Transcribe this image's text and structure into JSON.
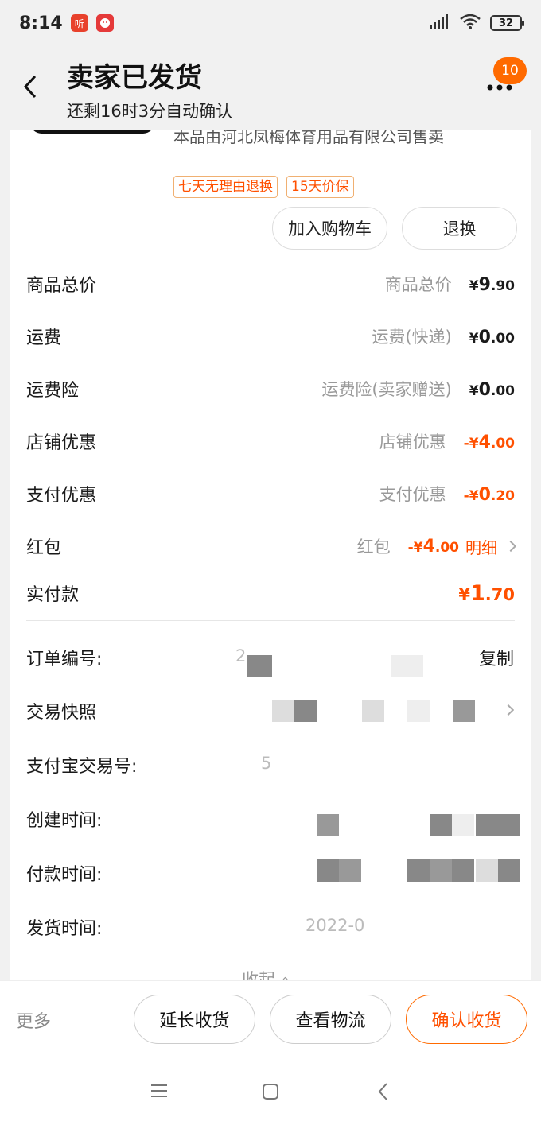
{
  "status": {
    "time": "8:14",
    "app1": "听",
    "app2": "",
    "battery": "32"
  },
  "header": {
    "title": "卖家已发货",
    "subtitle": "还剩16时3分自动确认",
    "badge": "10"
  },
  "product": {
    "seller_text": "本品由河北凤梅体育用品有限公司售卖",
    "tags": [
      "七天无理由退换",
      "15天价保"
    ],
    "add_cart": "加入购物车",
    "exchange": "退换"
  },
  "prices": [
    {
      "label": "商品总价",
      "sub": "商品总价",
      "yen": "¥",
      "int": "9",
      "dec": ".90",
      "orange": false
    },
    {
      "label": "运费",
      "sub": "运费(快递)",
      "yen": "¥",
      "int": "0",
      "dec": ".00",
      "orange": false
    },
    {
      "label": "运费险",
      "sub": "运费险(卖家赠送)",
      "yen": "¥",
      "int": "0",
      "dec": ".00",
      "orange": false
    },
    {
      "label": "店铺优惠",
      "sub": "店铺优惠",
      "yen": "-¥",
      "int": "4",
      "dec": ".00",
      "orange": true
    },
    {
      "label": "支付优惠",
      "sub": "支付优惠",
      "yen": "-¥",
      "int": "0",
      "dec": ".20",
      "orange": true
    },
    {
      "label": "红包",
      "sub": "红包",
      "yen": "-¥",
      "int": "4",
      "dec": ".00",
      "orange": true,
      "detail": "明细"
    }
  ],
  "paid": {
    "label": "实付款",
    "yen": "¥",
    "int": "1",
    "dec": ".70"
  },
  "order_info": {
    "order_no_label": "订单编号:",
    "order_no_value": "2",
    "copy": "复制",
    "snapshot_label": "交易快照",
    "alipay_label": "支付宝交易号:",
    "alipay_value": "5",
    "created_label": "创建时间:",
    "paid_label": "付款时间:",
    "shipped_label": "发货时间:",
    "shipped_value": "2022-0"
  },
  "collapse_label": "收起",
  "bottom": {
    "more": "更多",
    "extend": "延长收货",
    "logistics": "查看物流",
    "confirm": "确认收货"
  },
  "colors": {
    "accent": "#ff5000",
    "badge": "#ff6a00"
  }
}
